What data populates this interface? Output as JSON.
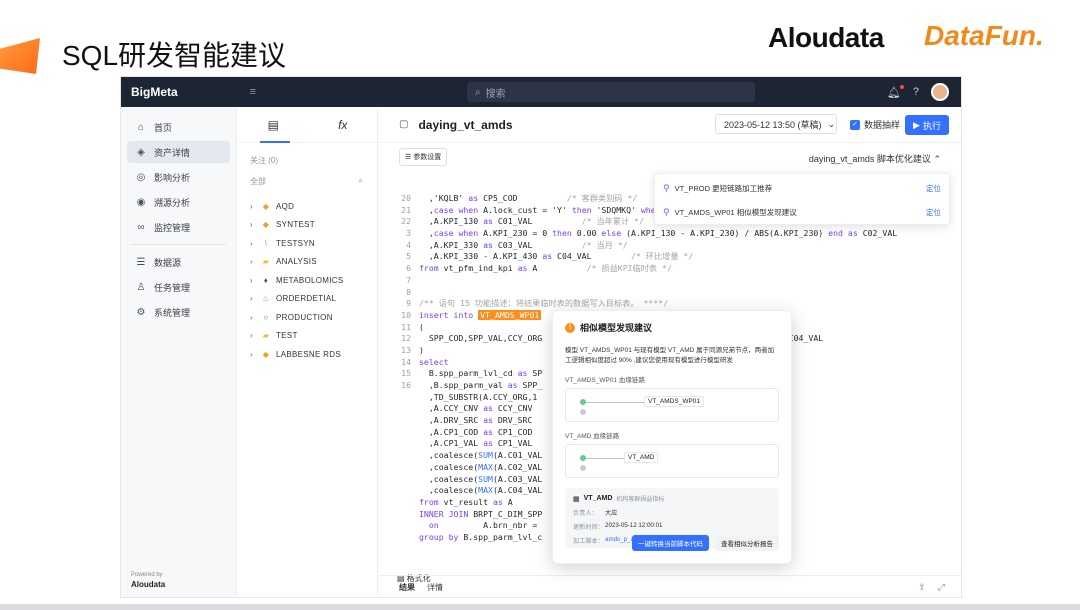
{
  "slide": {
    "title": "SQL研发智能建议",
    "logo_aloudata": "Aloudata",
    "logo_datafun": "DataFun."
  },
  "app": {
    "brand": "BigMeta",
    "search_placeholder": "搜索",
    "sidebar": {
      "items": [
        {
          "icon": "home-icon",
          "label": "首页"
        },
        {
          "icon": "layers-icon",
          "label": "资产详情"
        },
        {
          "icon": "target-icon",
          "label": "影响分析"
        },
        {
          "icon": "trace-icon",
          "label": "溯源分析"
        },
        {
          "icon": "monitor-icon",
          "label": "监控管理"
        },
        {
          "icon": "database-icon",
          "label": "数据源"
        },
        {
          "icon": "task-icon",
          "label": "任务管理"
        },
        {
          "icon": "settings-icon",
          "label": "系统管理"
        }
      ],
      "powered_by": "Powered by",
      "powered_brand": "Aloudata"
    },
    "tree": {
      "tab_fx": "fx",
      "follow_label": "关注 (0)",
      "all_label": "全部",
      "items": [
        "AQD",
        "SYNTEST",
        "TESTSYN",
        "ANALYSIS",
        "METABOLOMICS",
        "ORDERDETIAL",
        "PRODUCTION",
        "TEST",
        "LABBESNE RDS"
      ]
    },
    "file": {
      "name": "daying_vt_amds",
      "version": "2023-05-12 13:50 (草稿)",
      "sample_label": "数据抽样",
      "run_label": "执行",
      "param_label": "参数设置",
      "opt_title": "daying_vt_amds 脚本优化建议"
    },
    "suggestions": [
      {
        "label": "VT_PROD 更短链路加工推荐",
        "action": "定位"
      },
      {
        "label": "VT_AMDS_WP01 相似模型发现建议",
        "action": "定位"
      }
    ],
    "format_label": "格式化",
    "bottom_tabs": [
      "结果",
      "详情"
    ]
  },
  "code_lines": [
    {
      "n": "20",
      "t": "  ,'KQLB' as CP5_COD          /* 客群类别码 */"
    },
    {
      "n": "21",
      "t": "  ,case when A.lock_cust = 'Y' then 'SDQMKQ' when A.lock_cust = 'N' then"
    },
    {
      "n": "22",
      "t": "  ,A.KPI_130 as C01_VAL          /* 当年累计 */"
    },
    {
      "n": "3",
      "t": "  ,case when A.KPI_230 = 0 then 0.00 else (A.KPI_130 - A.KPI_230) / ABS(A.KPI_230) end as C02_VAL"
    },
    {
      "n": "4",
      "t": "  ,A.KPI_330 as C03_VAL          /* 当月 */"
    },
    {
      "n": "5",
      "t": "  ,A.KPI_330 - A.KPI_430 as C04_VAL        /* 环比增量 */"
    },
    {
      "n": "6",
      "t": "from vt_pfm_ind_kpi as A          /* 损益KPI临时表 */"
    },
    {
      "n": "7",
      "t": ""
    },
    {
      "n": "8",
      "t": ""
    },
    {
      "n": "9",
      "t": "/** 语句 15 功能描述：将结果临时表的数据写入目标表。 ****/"
    },
    {
      "n": "10",
      "t": "insert into VT_AMDS_WP01"
    },
    {
      "n": "11",
      "t": "("
    },
    {
      "n": "12",
      "t": "  SPP_COD,SPP_VAL,CCY_ORG                                          C03_VAL,C04_VAL"
    },
    {
      "n": "13",
      "t": ")"
    },
    {
      "n": "14",
      "t": "select"
    },
    {
      "n": "15",
      "t": "  B.spp_parm_lvl_cd as SP"
    },
    {
      "n": "16",
      "t": "  ,B.spp_parm_val as SPP_"
    },
    {
      "n": "",
      "t": "  ,TD_SUBSTR(A.CCY_ORG,1"
    },
    {
      "n": "",
      "t": "  ,A.CCY_CNV as CCY_CNV"
    },
    {
      "n": "",
      "t": "  ,A.DRV_SRC as DRV_SRC"
    },
    {
      "n": "",
      "t": "  ,A.CP1_COD as CP1_COD"
    },
    {
      "n": "",
      "t": "  ,A.CP1_VAL as CP1_VAL"
    },
    {
      "n": "",
      "t": "  ,coalesce(SUM(A.C01_VAL"
    },
    {
      "n": "",
      "t": "  ,coalesce(MAX(A.C02_VAL"
    },
    {
      "n": "",
      "t": "  ,coalesce(SUM(A.C03_VAL"
    },
    {
      "n": "",
      "t": "  ,coalesce(MAX(A.C04_VAL"
    },
    {
      "n": "",
      "t": "from vt_result as A"
    },
    {
      "n": "",
      "t": "INNER JOIN BRPT_C_DIM_SPP"
    },
    {
      "n": "",
      "t": "  on         A.brn_nbr ="
    },
    {
      "n": "",
      "t": "group by B.spp_parm_lvl_c                                  COD,A.CP1_VAL"
    }
  ],
  "dialog": {
    "title": "相似模型发现建议",
    "desc": "模型 VT_AMDS_WP01 与现有模型 VT_AMD 属于同源兄弟节点，两者加工逻辑相似度超过 90% ,建议您使用现有模型进行模型研发",
    "lineage1_label": "VT_AMDS_WP01 血缘链路",
    "lineage1_target": "VT_AMDS_WP01",
    "lineage2_label": "VT_AMD 血缘链路",
    "lineage2_target": "VT_AMD",
    "table_name": "VT_AMD",
    "table_sub": "机构客群损益指标",
    "owner_k": "负责人：",
    "owner_v": "大应",
    "updated_k": "更新时间：",
    "updated_v": "2023-05-12 12:00:01",
    "script_k": "加工脚本：",
    "script_v": "amds_p_amds_wp01267_a001",
    "btn_primary": "一键转换当前脚本代码",
    "btn_default": "查看相似分析报告"
  },
  "colors": {
    "accent": "#3370ff",
    "highlight": "#ff8d1a",
    "topbar": "#1d2433"
  }
}
